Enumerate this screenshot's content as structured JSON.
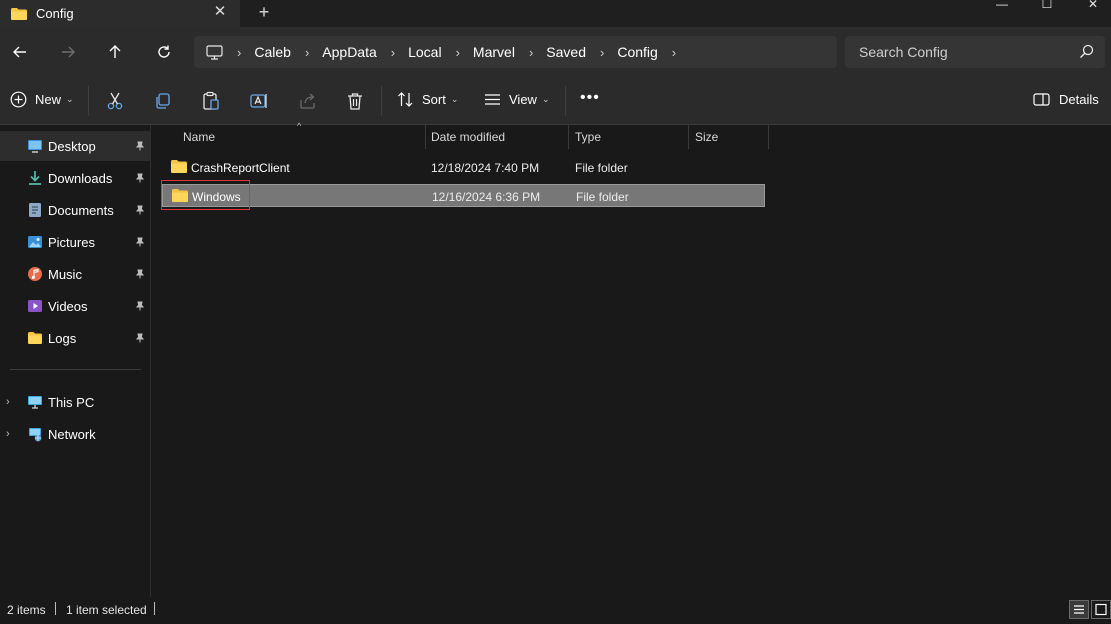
{
  "window": {
    "tab_title": "Config",
    "tab_close": "✕",
    "new_tab": "+",
    "minimize": "—",
    "maximize": "☐",
    "close": "✕"
  },
  "address_bar": {
    "breadcrumb": [
      "Caleb",
      "AppData",
      "Local",
      "Marvel",
      "Saved",
      "Config"
    ],
    "separator": "›",
    "search_placeholder": "Search Config"
  },
  "command_bar": {
    "new_label": "New",
    "sort_label": "Sort",
    "view_label": "View",
    "more_label": "•••",
    "details_label": "Details",
    "chevron": "⌄"
  },
  "sidebar": {
    "quick_access": [
      {
        "label": "Desktop",
        "icon": "desktop-icon",
        "pinned": true,
        "selected": true
      },
      {
        "label": "Downloads",
        "icon": "downloads-icon",
        "pinned": true
      },
      {
        "label": "Documents",
        "icon": "documents-icon",
        "pinned": true
      },
      {
        "label": "Pictures",
        "icon": "pictures-icon",
        "pinned": true
      },
      {
        "label": "Music",
        "icon": "music-icon",
        "pinned": true
      },
      {
        "label": "Videos",
        "icon": "videos-icon",
        "pinned": true
      },
      {
        "label": "Logs",
        "icon": "folder-icon",
        "pinned": true
      }
    ],
    "locations": [
      {
        "label": "This PC",
        "icon": "this-pc-icon"
      },
      {
        "label": "Network",
        "icon": "network-icon"
      }
    ],
    "pin_glyph": "📌",
    "expand_glyph": "›"
  },
  "file_list": {
    "columns": {
      "name": "Name",
      "date": "Date modified",
      "type": "Type",
      "size": "Size"
    },
    "sort_caret": "^",
    "rows": [
      {
        "name": "CrashReportClient",
        "date": "12/18/2024 7:40 PM",
        "type": "File folder",
        "size": ""
      },
      {
        "name": "Windows",
        "date": "12/16/2024 6:36 PM",
        "type": "File folder",
        "size": "",
        "selected": true
      }
    ]
  },
  "status_bar": {
    "item_count": "2 items",
    "selection": "1 item selected"
  },
  "colors": {
    "background": "#191919",
    "toolbar": "#2b2b2b",
    "selected_row": "#777777",
    "folder_yellow": "#f6c343",
    "highlight_red": "#e0343c"
  }
}
